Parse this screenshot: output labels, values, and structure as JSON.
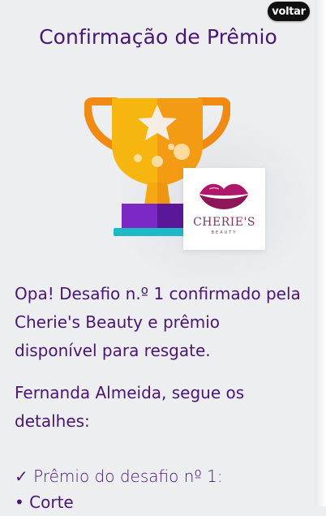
{
  "header": {
    "back_label": "voltar",
    "title": "Confirmação de Prêmio"
  },
  "brand": {
    "name": "CHERIE'S",
    "subtitle": "BEAUTY"
  },
  "message": {
    "confirmation": "Opa! Desafio n.º 1 confirmado pela Cherie's Beauty e prêmio disponível para resgate.",
    "greeting": "Fernanda Almeida, segue os detalhes:"
  },
  "prize": {
    "check_icon": "✓",
    "heading": "Prêmio do desafio nº 1:",
    "items": [
      "• Corte"
    ]
  },
  "colors": {
    "text_primary": "#4a1576",
    "background": "#eceef0",
    "back_button": "#111111",
    "trophy_gold": "#f7b50f",
    "trophy_base": "#6a1fa8",
    "trophy_plinth": "#1fb8c8"
  }
}
